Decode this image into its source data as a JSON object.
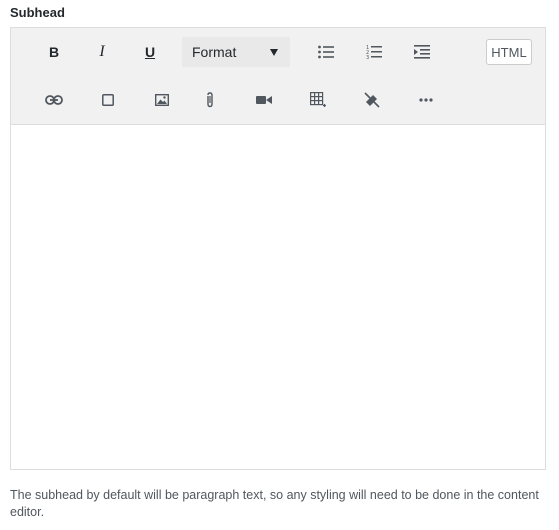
{
  "field": {
    "label": "Subhead"
  },
  "toolbar": {
    "bold_label": "B",
    "italic_label": "I",
    "underline_label": "U",
    "format_label": "Format",
    "html_label": "HTML",
    "icons": [
      "bold-icon",
      "italic-icon",
      "underline-icon",
      "bulleted-list-icon",
      "numbered-list-icon",
      "indent-icon",
      "link-icon",
      "square-icon",
      "image-icon",
      "paperclip-icon",
      "video-camera-icon",
      "table-icon",
      "eraser-icon",
      "more-icon"
    ]
  },
  "editor": {
    "content": ""
  },
  "help": {
    "text": "The subhead by default will be paragraph text, so any styling will need to be done in the content editor."
  }
}
